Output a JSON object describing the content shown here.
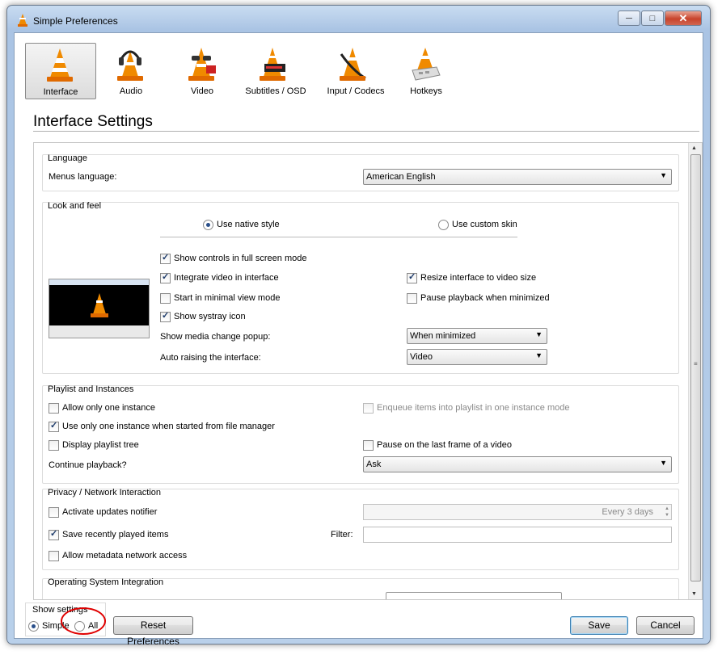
{
  "window": {
    "title": "Simple Preferences",
    "minimize": "─",
    "maximize": "□",
    "close": "✕"
  },
  "categories": [
    {
      "label": "Interface",
      "icon": "vlc-cone-icon",
      "selected": true
    },
    {
      "label": "Audio",
      "icon": "headphones-cone-icon",
      "selected": false
    },
    {
      "label": "Video",
      "icon": "glasses-cone-icon",
      "selected": false
    },
    {
      "label": "Subtitles / OSD",
      "icon": "subtitles-cone-icon",
      "selected": false
    },
    {
      "label": "Input / Codecs",
      "icon": "cable-cone-icon",
      "selected": false
    },
    {
      "label": "Hotkeys",
      "icon": "keyboard-cone-icon",
      "selected": false
    }
  ],
  "heading": "Interface Settings",
  "language": {
    "title": "Language",
    "menus_label": "Menus language:",
    "menus_value": "American English"
  },
  "look": {
    "title": "Look and feel",
    "native": "Use native style",
    "custom": "Use custom skin",
    "fullscreen_controls": "Show controls in full screen mode",
    "integrate_video": "Integrate video in interface",
    "resize_interface": "Resize interface to video size",
    "minimal_view": "Start in minimal view mode",
    "pause_minimized": "Pause playback when minimized",
    "systray": "Show systray icon",
    "popup_label": "Show media change popup:",
    "popup_value": "When minimized",
    "raise_label": "Auto raising the interface:",
    "raise_value": "Video"
  },
  "playlist": {
    "title": "Playlist and Instances",
    "one_instance": "Allow only one instance",
    "enqueue": "Enqueue items into playlist in one instance mode",
    "file_manager": "Use only one instance when started from file manager",
    "tree": "Display playlist tree",
    "pause_last": "Pause on the last frame of a video",
    "continue_label": "Continue playback?",
    "continue_value": "Ask"
  },
  "privacy": {
    "title": "Privacy / Network Interaction",
    "updates": "Activate updates notifier",
    "updates_value": "Every 3 days",
    "recent": "Save recently played items",
    "filter_label": "Filter:",
    "metadata": "Allow metadata network access"
  },
  "os": {
    "title": "Operating System Integration"
  },
  "footer": {
    "show_settings": "Show settings",
    "simple": "Simple",
    "all": "All",
    "reset": "Reset Preferences",
    "save": "Save",
    "cancel": "Cancel"
  },
  "colors": {
    "annotation_ring": "#e00000",
    "vlc_orange": "#f08a00"
  }
}
